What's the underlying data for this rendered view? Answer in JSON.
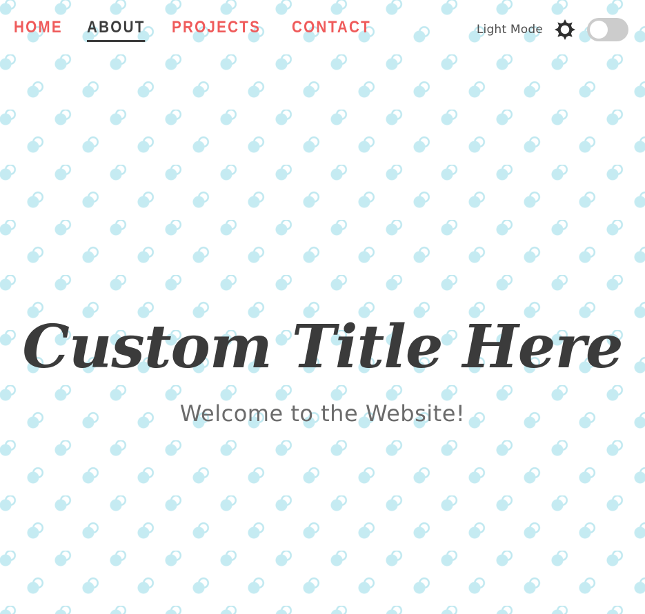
{
  "nav": {
    "items": [
      {
        "label": "HOME",
        "active": false
      },
      {
        "label": "ABOUT",
        "active": true
      },
      {
        "label": "PROJECTS",
        "active": false
      },
      {
        "label": "CONTACT",
        "active": false
      }
    ]
  },
  "theme": {
    "label": "Light Mode",
    "icon": "sun-icon",
    "toggle_on": false
  },
  "hero": {
    "title": "Custom Title Here",
    "subtitle": "Welcome to the Website!"
  },
  "colors": {
    "nav_link": "#ef5b5b",
    "nav_active": "#3c3c3c",
    "pattern": "#c5ebf2",
    "title": "#3b3b3b",
    "subtitle": "#6b6b6b",
    "toggle_off": "#cccccc"
  }
}
